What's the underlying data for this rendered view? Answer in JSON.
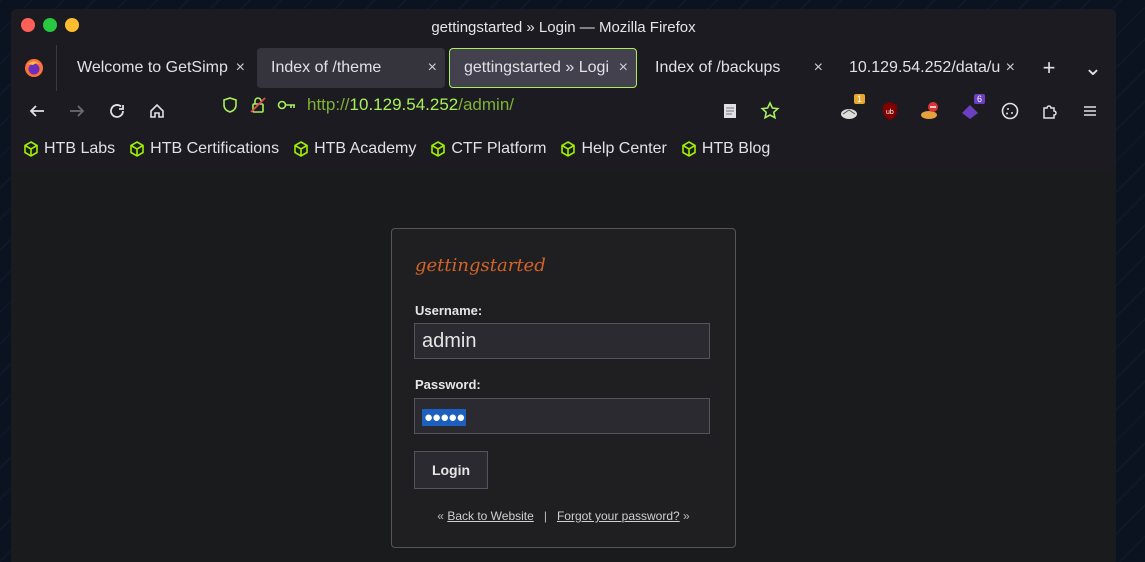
{
  "window": {
    "title": "gettingstarted » Login — Mozilla Firefox"
  },
  "tabs": [
    {
      "label": "Welcome to GetSimp",
      "close": "×"
    },
    {
      "label": "Index of /theme",
      "close": "×"
    },
    {
      "label": "gettingstarted » Logi",
      "close": "×"
    },
    {
      "label": "Index of /backups",
      "close": "×"
    },
    {
      "label": "10.129.54.252/data/u",
      "close": "×"
    }
  ],
  "tabbar": {
    "new_tab": "+",
    "list_tabs": "⌄"
  },
  "urlbar": {
    "prefix": "http://",
    "host": "10.129.54.252",
    "path": "/admin/"
  },
  "extensions": {
    "badge_1": "1",
    "badge_2": "6"
  },
  "bookmarks": [
    "HTB Labs",
    "HTB Certifications",
    "HTB Academy",
    "CTF Platform",
    "Help Center",
    "HTB Blog"
  ],
  "login": {
    "site_name": "gettingstarted",
    "username_label": "Username:",
    "username_value": "admin",
    "password_label": "Password:",
    "password_value": "●●●●●",
    "button": "Login",
    "prefix": "«",
    "back_link": "Back to Website",
    "separator": "|",
    "forgot_link": "Forgot your password?",
    "suffix": "»"
  },
  "colors": {
    "accent": "#a7f05a",
    "site_name": "#d2632b",
    "selection": "#1d5fbf"
  }
}
